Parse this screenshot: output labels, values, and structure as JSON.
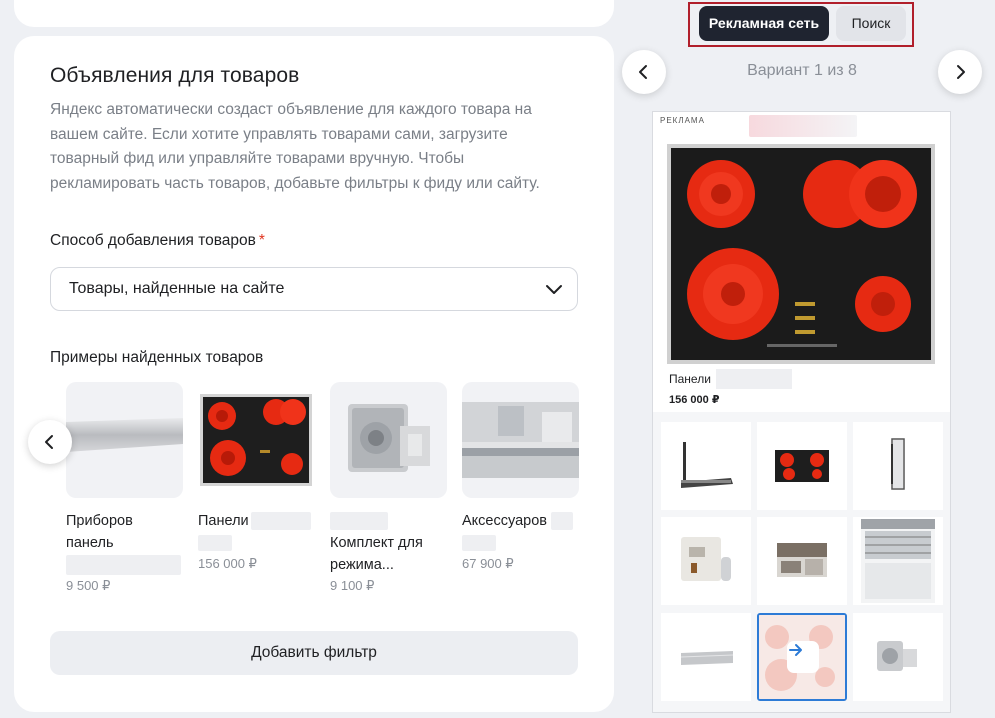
{
  "section": {
    "title": "Объявления для товаров",
    "description": "Яндекс автоматически создаст объявление для каждого товара на вашем сайте. Если хотите управлять товарами сами, загрузите товарный фид или управляйте товарами вручную. Чтобы рекламировать часть товаров, добавьте фильтры к фиду или сайту.",
    "method_label": "Способ добавления товаров",
    "required_mark": "*",
    "method_value": "Товары, найденные на сайте",
    "examples_label": "Примеры найденных товаров",
    "products": [
      {
        "name_lines": [
          "Приборов",
          "панель"
        ],
        "price": "9 500 ₽",
        "icon": "trim-panel-image"
      },
      {
        "name_lines": [
          "Панели"
        ],
        "price": "156 000 ₽",
        "icon": "hob-image"
      },
      {
        "name_lines": [
          "Комплект для",
          "режима..."
        ],
        "price": "9 100 ₽",
        "icon": "kit-image"
      },
      {
        "name_lines": [
          "Аксессуаров"
        ],
        "price": "67 900 ₽",
        "icon": "kitchen-image"
      }
    ],
    "add_filter": "Добавить фильтр"
  },
  "preview": {
    "tabs": [
      "Рекламная сеть",
      "Поиск"
    ],
    "active_tab": "Рекламная сеть",
    "variant": "Вариант 1 из 8",
    "ad_mark": "РЕКЛАМА",
    "product_name": "Панели",
    "product_price": "156 000 ₽",
    "accent": "#1f2430",
    "highlight": "#b11f2b",
    "selected_border": "#2d7bd6"
  }
}
